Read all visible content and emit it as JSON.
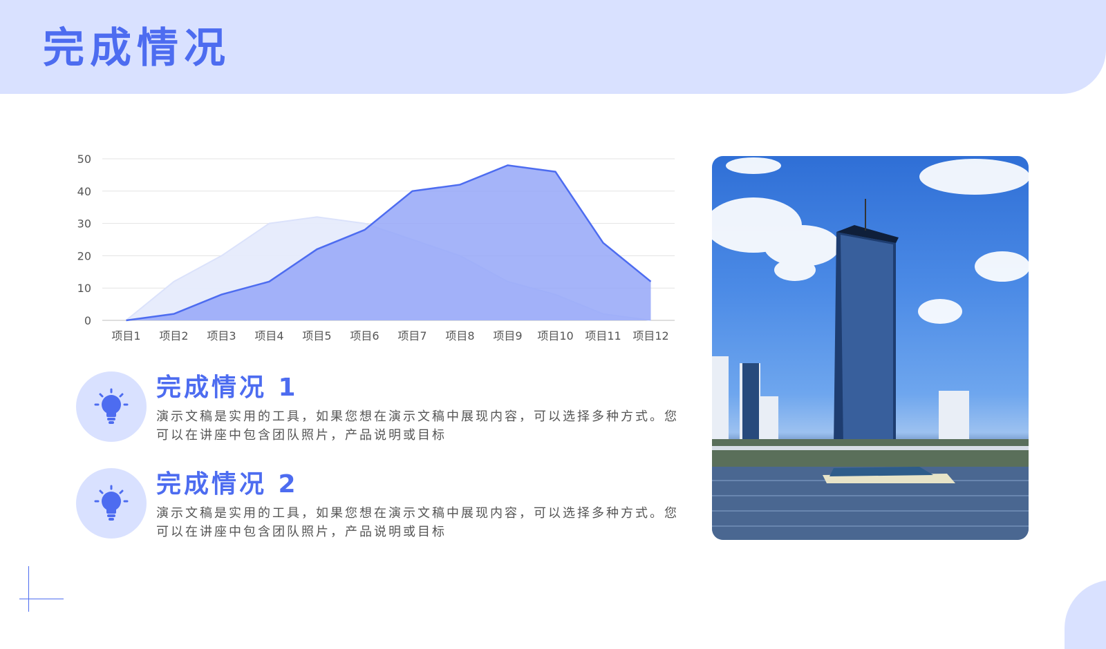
{
  "page": {
    "title": "完成情况"
  },
  "chart_data": {
    "type": "area",
    "categories": [
      "项目1",
      "项目2",
      "项目3",
      "项目4",
      "项目5",
      "项目6",
      "项目7",
      "项目8",
      "项目9",
      "项目10",
      "项目11",
      "项目12"
    ],
    "series": [
      {
        "values": [
          0,
          12,
          20,
          30,
          32,
          30,
          25,
          20,
          12,
          8,
          2,
          0
        ],
        "color": "#e6ebfc"
      },
      {
        "values": [
          0,
          2,
          8,
          12,
          22,
          28,
          40,
          42,
          48,
          46,
          24,
          12
        ],
        "color": "#95a7f8"
      }
    ],
    "yticks": [
      0,
      10,
      20,
      30,
      40,
      50
    ],
    "ylim": [
      0,
      50
    ],
    "grid": true,
    "title": "",
    "xlabel": "",
    "ylabel": ""
  },
  "items": [
    {
      "title": "完成情况 1",
      "text": "演示文稿是实用的工具，如果您想在演示文稿中展现内容，可以选择多种方式。您可以在讲座中包含团队照片，产品说明或目标",
      "icon": "lightbulb-icon"
    },
    {
      "title": "完成情况 2",
      "text": "演示文稿是实用的工具，如果您想在演示文稿中展现内容，可以选择多种方式。您可以在讲座中包含团队照片，产品说明或目标",
      "icon": "lightbulb-icon"
    }
  ],
  "colors": {
    "accent": "#4d6cf0",
    "band": "#d9e1ff",
    "area_light": "#e6ebfc",
    "area_main": "#95a7f8"
  },
  "image": {
    "subject": "photo"
  }
}
